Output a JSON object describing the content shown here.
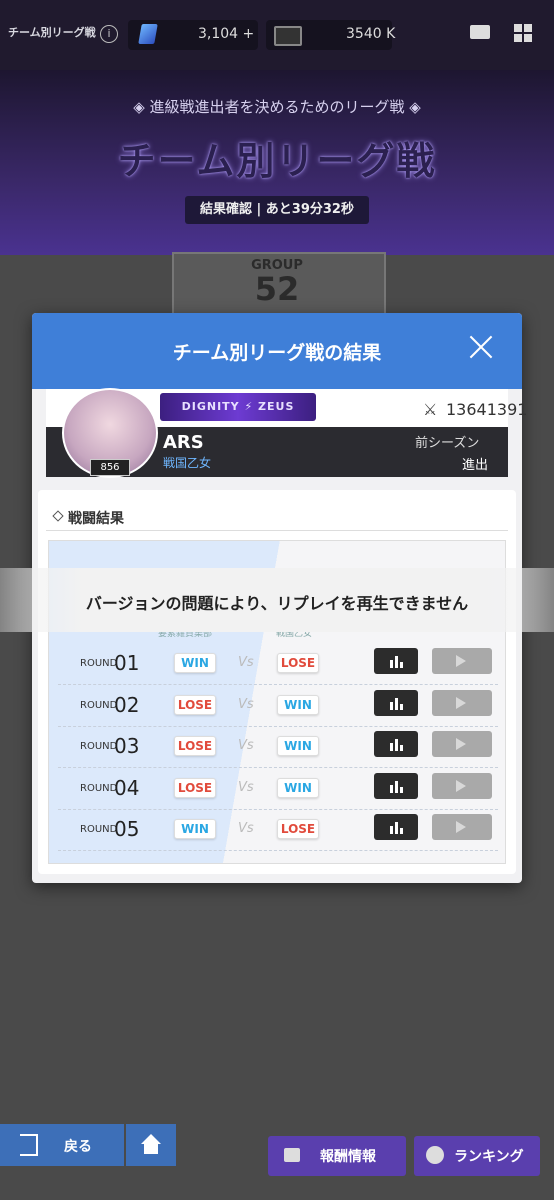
{
  "header": {
    "title": "チーム別リーグ戦",
    "gems": "3,104 +",
    "tickets": "3540 K"
  },
  "banner": {
    "subtitle": "◈ 進級戦進出者を決めるためのリーグ戦 ◈",
    "title": "チーム別リーグ戦",
    "status": "結果確認 | あと39分32秒"
  },
  "group": {
    "label": "GROUP",
    "number": "52"
  },
  "modal": {
    "title": "チーム別リーグ戦の結果"
  },
  "team": {
    "level": "856",
    "emblem": "DIGNITY ⚡ ZEUS",
    "power": "13641391",
    "name": "ARS",
    "subname": "戦国乙女",
    "prev_label": "前シーズン",
    "prev_value": "進出"
  },
  "results": {
    "section_title": "戦闘結果",
    "col_left": "要素雑貨集部",
    "col_right": "戦国乙女",
    "round_label": "ROUND",
    "rounds": [
      {
        "no": "01",
        "left": "WIN",
        "right": "LOSE"
      },
      {
        "no": "02",
        "left": "LOSE",
        "right": "WIN"
      },
      {
        "no": "03",
        "left": "LOSE",
        "right": "WIN"
      },
      {
        "no": "04",
        "left": "LOSE",
        "right": "WIN"
      },
      {
        "no": "05",
        "left": "WIN",
        "right": "LOSE"
      }
    ],
    "vs": "Vs"
  },
  "toast": "バージョンの問題により、リプレイを再生できません",
  "footer": {
    "back": "戻る",
    "reward": "報酬情報",
    "ranking": "ランキング"
  }
}
